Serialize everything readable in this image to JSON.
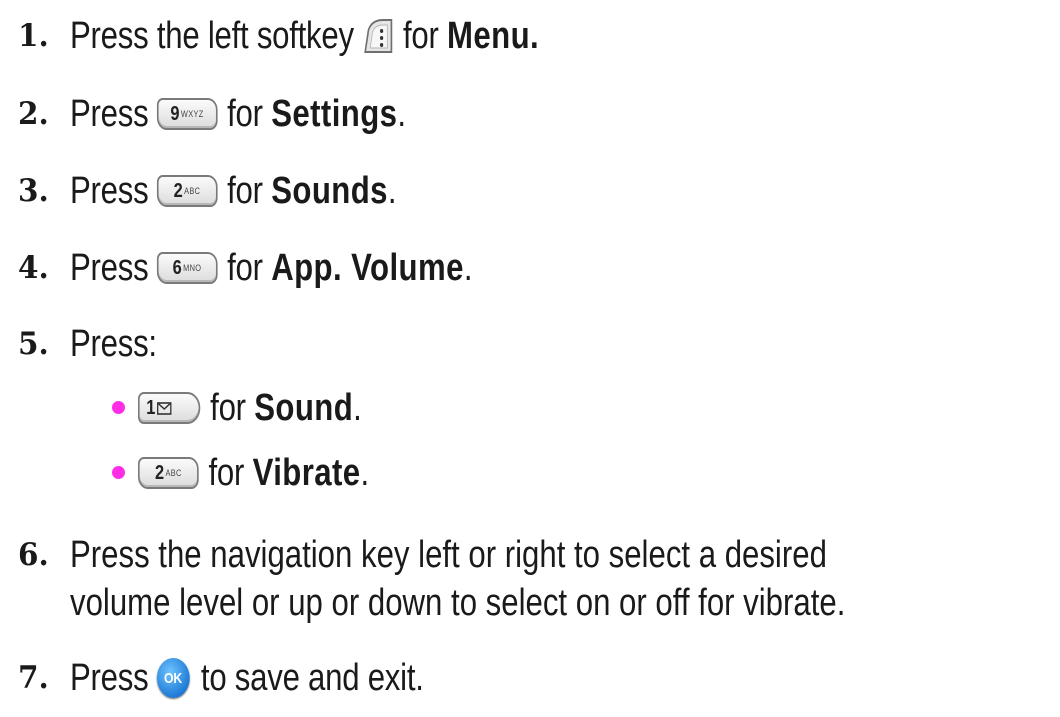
{
  "steps": [
    {
      "num": "1.",
      "pre": "Press the left softkey",
      "post": "for",
      "bold": "Menu.",
      "end": "",
      "key": {
        "icon": "left-softkey-icon"
      }
    },
    {
      "num": "2.",
      "pre": "Press",
      "post": "for",
      "bold": "Settings",
      "end": ".",
      "key": {
        "digit": "9",
        "letters": "WXYZ"
      }
    },
    {
      "num": "3.",
      "pre": "Press",
      "post": "for",
      "bold": "Sounds",
      "end": ".",
      "key": {
        "digit": "2",
        "letters": "ABC"
      }
    },
    {
      "num": "4.",
      "pre": "Press",
      "post": "for",
      "bold": "App. Volume",
      "end": ".",
      "key": {
        "digit": "6",
        "letters": "MNO"
      }
    },
    {
      "num": "5.",
      "pre": "Press:"
    }
  ],
  "sub_steps": [
    {
      "post": "for",
      "bold": "Sound",
      "end": ".",
      "key": {
        "digit": "1",
        "icon": "envelope-icon"
      }
    },
    {
      "post": "for",
      "bold": "Vibrate",
      "end": ".",
      "key": {
        "digit": "2",
        "letters": "ABC"
      }
    }
  ],
  "step6": {
    "num": "6.",
    "line1": "Press the navigation key left or right to select a desired",
    "line2": "volume level or up or down to select on or off for vibrate."
  },
  "step7": {
    "num": "7.",
    "pre": "Press",
    "key_label": "OK",
    "post": "to save and exit."
  },
  "colors": {
    "bullet": "#ff2de6",
    "ok_key": "#1f7bd6"
  }
}
